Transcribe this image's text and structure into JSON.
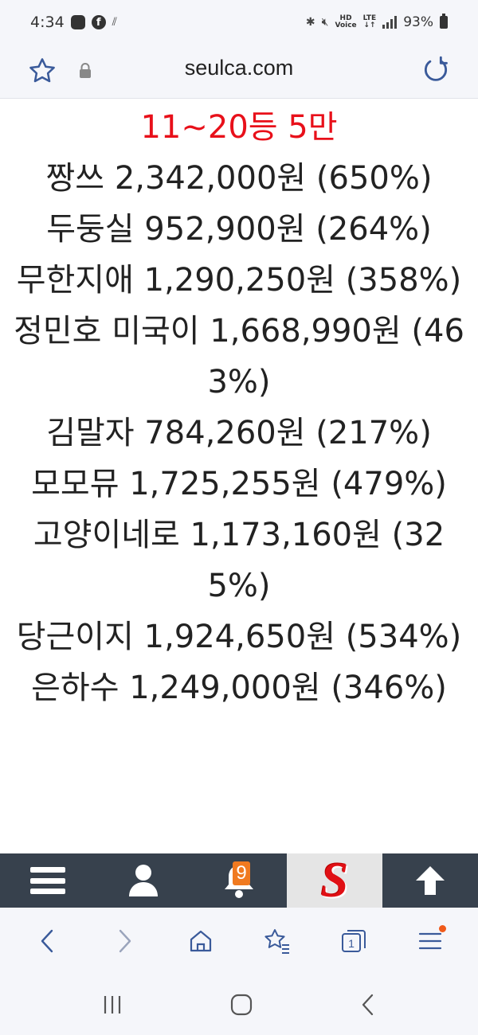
{
  "status_bar": {
    "time": "4:34",
    "battery": "93%",
    "network": "LTE",
    "hd_label_top": "HD",
    "hd_label_bottom": "Voice"
  },
  "address_bar": {
    "url": "seulca.com"
  },
  "content": {
    "headline": "11~20등 5만",
    "entries": [
      "짱쓰 2,342,000원 (650%)",
      "두둥실 952,900원 (264%)",
      "무한지애 1,290,250원 (358%)",
      "정민호 미국이 1,668,990원 (463%)",
      "김말자 784,260원 (217%)",
      "모모뮤 1,725,255원 (479%)",
      "고양이네로 1,173,160원 (325%)",
      "당근이지 1,924,650원 (534%)",
      "은하수 1,249,000원 (346%)"
    ]
  },
  "site_toolbar": {
    "notification_count": "9",
    "logo_letter": "S"
  },
  "browser_nav": {
    "tab_count": "1"
  },
  "colors": {
    "headline": "#e8101a",
    "toolbar_bg": "#37414d",
    "badge": "#f07a20",
    "accent_icon": "#3a5a9a"
  }
}
